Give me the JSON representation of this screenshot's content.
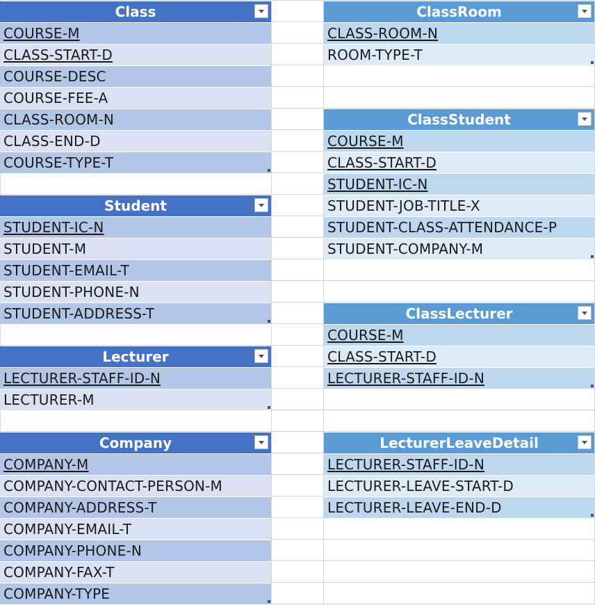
{
  "tables": {
    "class": {
      "header": "Class",
      "fields": [
        "COURSE-M",
        "CLASS-START-D",
        "COURSE-DESC",
        "COURSE-FEE-A",
        "CLASS-ROOM-N",
        "CLASS-END-D",
        "COURSE-TYPE-T"
      ]
    },
    "student": {
      "header": "Student",
      "fields": [
        "STUDENT-IC-N",
        "STUDENT-M",
        "STUDENT-EMAIL-T",
        "STUDENT-PHONE-N",
        "STUDENT-ADDRESS-T"
      ]
    },
    "lecturer": {
      "header": "Lecturer",
      "fields": [
        "LECTURER-STAFF-ID-N",
        "LECTURER-M"
      ]
    },
    "company": {
      "header": "Company",
      "fields": [
        "COMPANY-M",
        "COMPANY-CONTACT-PERSON-M",
        "COMPANY-ADDRESS-T",
        "COMPANY-EMAIL-T",
        "COMPANY-PHONE-N",
        "COMPANY-FAX-T",
        "COMPANY-TYPE"
      ]
    },
    "classroom": {
      "header": "ClassRoom",
      "fields": [
        "CLASS-ROOM-N",
        "ROOM-TYPE-T"
      ]
    },
    "classstudent": {
      "header": "ClassStudent",
      "fields": [
        "COURSE-M",
        "CLASS-START-D",
        "STUDENT-IC-N",
        "STUDENT-JOB-TITLE-X",
        "STUDENT-CLASS-ATTENDANCE-P",
        "STUDENT-COMPANY-M"
      ]
    },
    "classlecturer": {
      "header": "ClassLecturer",
      "fields": [
        "COURSE-M",
        "CLASS-START-D",
        "LECTURER-STAFF-ID-N"
      ]
    },
    "lecturerleavedetail": {
      "header": "LecturerLeaveDetail",
      "fields": [
        "LECTURER-STAFF-ID-N",
        "LECTURER-LEAVE-START-D",
        "LECTURER-LEAVE-END-D"
      ]
    }
  },
  "colors": {
    "left_header": "#4472c4",
    "left_band_dark": "#b4c6e7",
    "left_band_light": "#d9e1f2",
    "right_header": "#5b9bd5",
    "right_band_dark": "#bdd7ee",
    "right_band_light": "#ddebf7"
  }
}
